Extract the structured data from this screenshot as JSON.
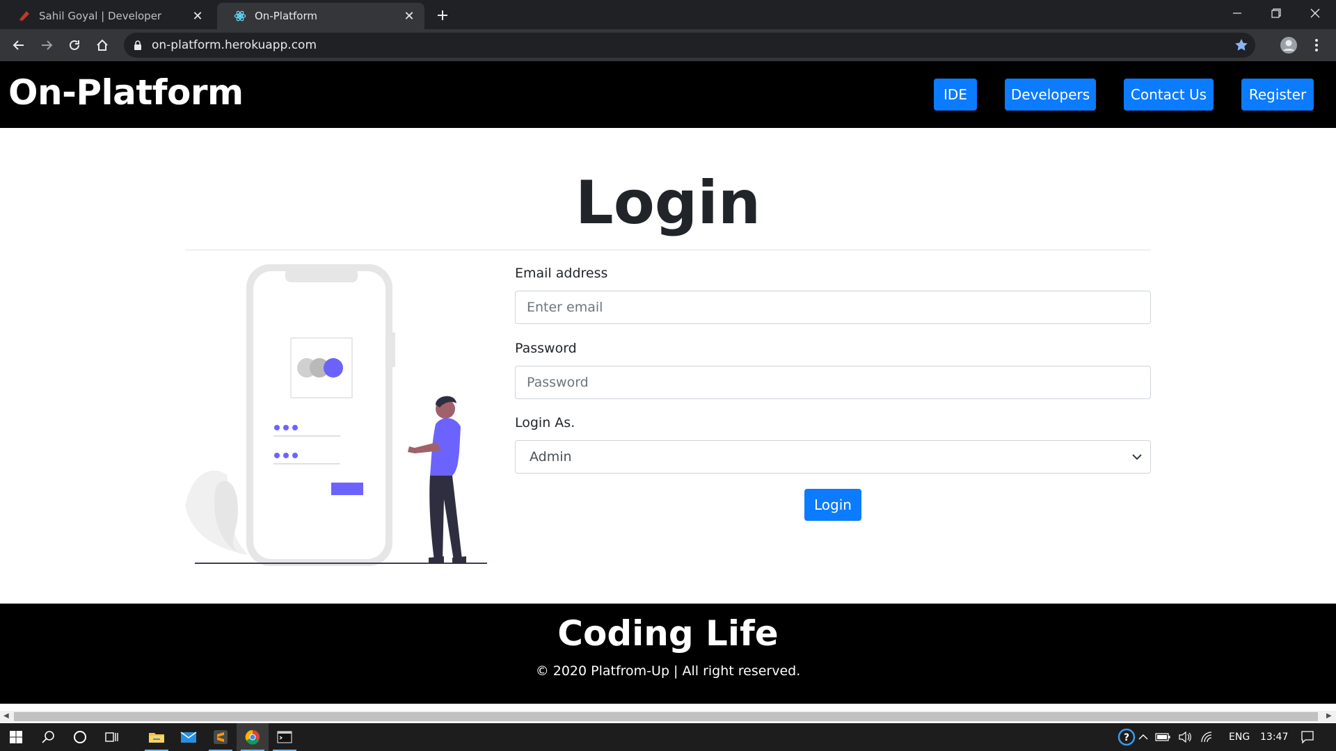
{
  "browser": {
    "tabs": [
      {
        "title": "Sahil Goyal | Developer",
        "icon": "developer-favicon",
        "active": false
      },
      {
        "title": "On-Platform",
        "icon": "react-favicon",
        "active": true
      }
    ],
    "new_tab_icon": "plus-icon",
    "url": "on-platform.herokuapp.com"
  },
  "site": {
    "brand": "On-Platform",
    "nav": [
      {
        "label": "IDE"
      },
      {
        "label": "Developers"
      },
      {
        "label": "Contact Us"
      },
      {
        "label": "Register"
      }
    ],
    "accent": "#0b7bff"
  },
  "login": {
    "title": "Login",
    "email_label": "Email address",
    "email_placeholder": "Enter email",
    "password_label": "Password",
    "password_placeholder": "Password",
    "role_label": "Login As.",
    "role_selected": "Admin",
    "submit_label": "Login"
  },
  "footer": {
    "title": "Coding Life",
    "copyright": "© 2020 Platfrom-Up | All right reserved."
  },
  "taskbar": {
    "language": "ENG",
    "time": "13:47"
  }
}
